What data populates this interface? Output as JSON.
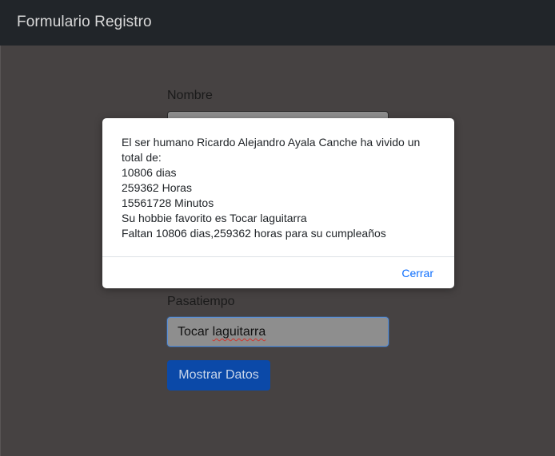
{
  "navbar": {
    "brand": "Formulario Registro"
  },
  "form": {
    "name_label": "Nombre",
    "name_value": "",
    "hobby_label": "Pasatiempo",
    "hobby_value_prefix": "Tocar ",
    "hobby_value_misspelled": "laguitarra",
    "submit_label": "Mostrar Datos"
  },
  "modal": {
    "lines": [
      "El ser humano Ricardo Alejandro Ayala Canche ha vivido un",
      "total de:",
      "10806 dias",
      "259362 Horas",
      "15561728 Minutos",
      "Su hobbie favorito es Tocar laguitarra",
      "Faltan 10806 dias,259362 horas para su cumpleaños"
    ],
    "close_label": "Cerrar"
  },
  "colors": {
    "navbar_bg": "#212529",
    "backdrop": "#464242",
    "primary": "#0d6efd",
    "submit_bg": "#0b49a8"
  }
}
